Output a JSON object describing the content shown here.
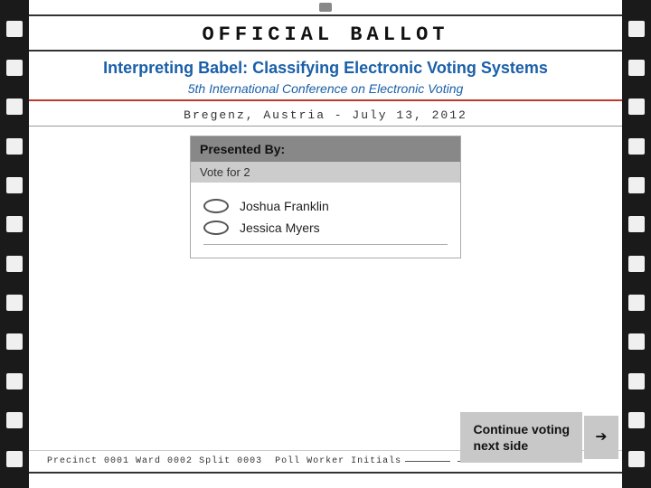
{
  "page": {
    "title": "OFFICIAL BALLOT",
    "title_letter_spacing": "5px"
  },
  "contest": {
    "title": "Interpreting Babel: Classifying Electronic Voting Systems",
    "subtitle": "5th International Conference on Electronic Voting"
  },
  "location": {
    "text": "Bregenz, Austria - July 13, 2012"
  },
  "table": {
    "header": "Presented By:",
    "subheader": "Vote for 2",
    "candidates": [
      {
        "name": "Joshua Franklin"
      },
      {
        "name": "Jessica Myers"
      }
    ]
  },
  "continue_button": {
    "line1": "Continue voting",
    "line2": "next side",
    "arrow": "➔"
  },
  "footer": {
    "precinct": "Precinct 0001",
    "ward": "Ward 0002",
    "split": "Split 0003",
    "poll_worker": "Poll Worker Initials"
  }
}
